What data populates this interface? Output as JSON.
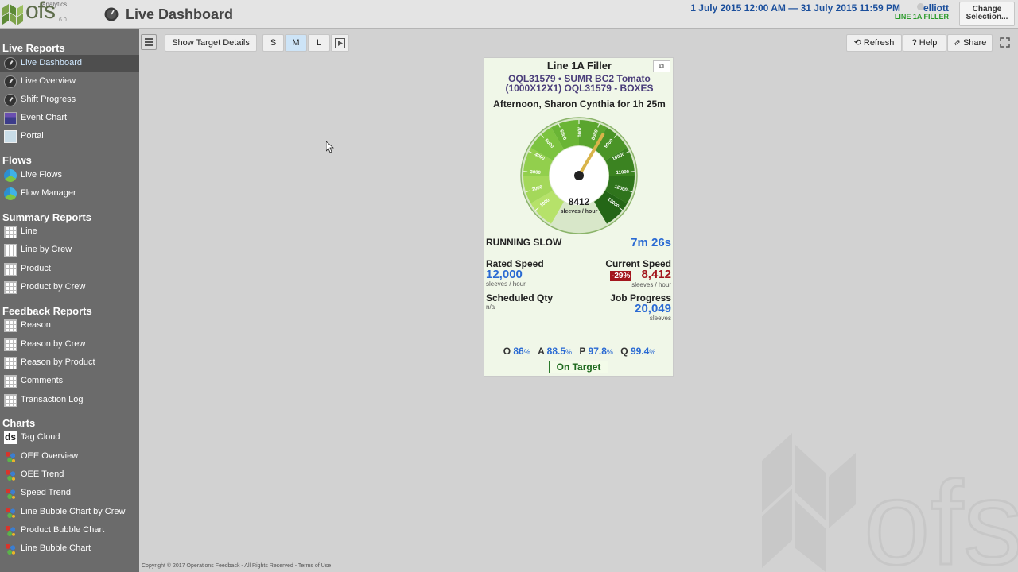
{
  "header": {
    "logo_text": "ofs",
    "logo_sub": "analytics",
    "logo_version": "6.0",
    "title": "Live Dashboard",
    "date_range": "1 July 2015 12:00 AM — 31 July 2015 11:59 PM",
    "username": "elliott",
    "line_label": "LINE 1A FILLER",
    "change_line1": "Change",
    "change_line2": "Selection..."
  },
  "sidebar": {
    "sections": [
      {
        "title": "Live Reports",
        "items": [
          {
            "label": "Live Dashboard",
            "icon": "gauge-icon",
            "active": true
          },
          {
            "label": "Live Overview",
            "icon": "gauge-icon"
          },
          {
            "label": "Shift Progress",
            "icon": "gauge-icon"
          },
          {
            "label": "Event Chart",
            "icon": "event-chart-icon"
          },
          {
            "label": "Portal",
            "icon": "portal-icon"
          }
        ]
      },
      {
        "title": "Flows",
        "items": [
          {
            "label": "Live Flows",
            "icon": "flow-icon"
          },
          {
            "label": "Flow Manager",
            "icon": "flow-icon"
          }
        ]
      },
      {
        "title": "Summary Reports",
        "items": [
          {
            "label": "Line",
            "icon": "grid-icon"
          },
          {
            "label": "Line by Crew",
            "icon": "grid-icon"
          },
          {
            "label": "Product",
            "icon": "grid-icon"
          },
          {
            "label": "Product by Crew",
            "icon": "grid-icon"
          }
        ]
      },
      {
        "title": "Feedback Reports",
        "items": [
          {
            "label": "Reason",
            "icon": "grid-icon"
          },
          {
            "label": "Reason by Crew",
            "icon": "grid-icon"
          },
          {
            "label": "Reason by Product",
            "icon": "grid-icon"
          },
          {
            "label": "Comments",
            "icon": "grid-icon"
          },
          {
            "label": "Transaction Log",
            "icon": "grid-icon"
          }
        ]
      },
      {
        "title": "Charts",
        "items": [
          {
            "label": "Tag Cloud",
            "icon": "tag-cloud-icon",
            "glyph": "ds"
          },
          {
            "label": "OEE Overview",
            "icon": "chart-dots-icon"
          },
          {
            "label": "OEE Trend",
            "icon": "chart-dots-icon"
          },
          {
            "label": "Speed Trend",
            "icon": "chart-dots-icon"
          },
          {
            "label": "Line Bubble Chart by Crew",
            "icon": "chart-dots-icon"
          },
          {
            "label": "Product Bubble Chart",
            "icon": "chart-dots-icon"
          },
          {
            "label": "Line Bubble Chart",
            "icon": "chart-dots-icon"
          }
        ]
      }
    ]
  },
  "toolbar": {
    "show_target": "Show Target Details",
    "size_s": "S",
    "size_m": "M",
    "size_l": "L",
    "selected_size": "M",
    "refresh": "Refresh",
    "help": "Help",
    "share": "Share"
  },
  "card": {
    "title": "Line 1A Filler",
    "product_line1": "OQL31579 • SUMR BC2 Tomato",
    "product_line2": "(1000X12X1) OQL31579 - BOXES",
    "shift": "Afternoon, Sharon Cynthia for 1h 25m",
    "gauge": {
      "value": 8412,
      "value_text": "8412",
      "unit": "sleeves / hour",
      "min": 0,
      "max": 14000,
      "ticks": [
        "1000",
        "2000",
        "3000",
        "4000",
        "5000",
        "6000",
        "7000",
        "8000",
        "9000",
        "10000",
        "11000",
        "12000",
        "13000"
      ]
    },
    "status": "RUNNING SLOW",
    "status_time": "7m 26s",
    "rated_speed_label": "Rated Speed",
    "rated_speed_value": "12,000",
    "rated_speed_unit": "sleeves / hour",
    "current_speed_label": "Current Speed",
    "current_speed_pct": "-29%",
    "current_speed_value": "8,412",
    "current_speed_unit": "sleeves / hour",
    "scheduled_label": "Scheduled Qty",
    "scheduled_value": "n/a",
    "job_progress_label": "Job Progress",
    "job_progress_value": "20,049",
    "job_progress_unit": "sleeves",
    "kpis": [
      {
        "letter": "O",
        "value": "86",
        "pct": "%"
      },
      {
        "letter": "A",
        "value": "88.5",
        "pct": "%"
      },
      {
        "letter": "P",
        "value": "97.8",
        "pct": "%"
      },
      {
        "letter": "Q",
        "value": "99.4",
        "pct": "%"
      }
    ],
    "on_target": "On Target"
  },
  "footer": {
    "copyright": "Copyright © 2017 Operations Feedback - All Rights Reserved - ",
    "terms": "Terms of Use"
  },
  "colors": {
    "accent_blue": "#2a6ad3",
    "alert_red": "#a3161d",
    "ok_green": "#2a9a2a"
  }
}
